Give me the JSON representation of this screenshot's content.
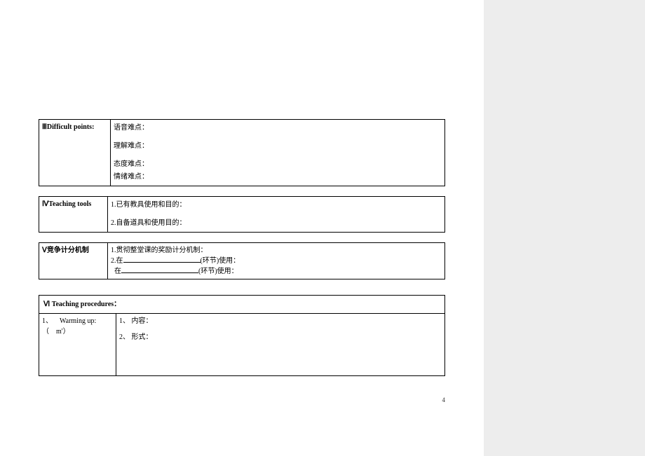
{
  "page_number": "4",
  "section3": {
    "label": "ⅢDifficult points:",
    "line1": "语音难点：",
    "line2": "理解难点：",
    "line3": "态度难点：",
    "line4": "情绪难点："
  },
  "section4": {
    "label": "ⅣTeaching tools",
    "line1": "1.已有教具使用和目的：",
    "line2": "2.自备道具和使用目的："
  },
  "section5": {
    "label": "Ⅴ竞争计分机制",
    "line1": "1.贯彻整堂课的奖励计分机制：",
    "line2_prefix": "2.在",
    "line2_suffix": "(环节)使用：",
    "line3_prefix_spacer": "  在",
    "line3_suffix": "(环节)使用："
  },
  "section6": {
    "header_roman": "Ⅵ",
    "header_text": "Teaching procedures：",
    "row1_label_line1": "1、    Warming up:",
    "row1_label_line2": "（    m'）",
    "row1_content_line1": "1、 内容：",
    "row1_content_line2": "2、 形式："
  }
}
